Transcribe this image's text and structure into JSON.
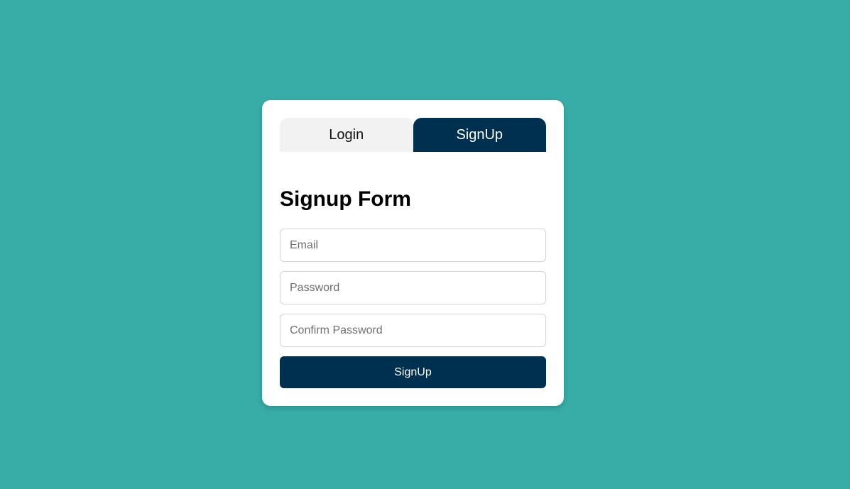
{
  "tabs": [
    {
      "label": "Login",
      "active": false
    },
    {
      "label": "SignUp",
      "active": true
    }
  ],
  "form": {
    "title": "Signup Form",
    "email": {
      "placeholder": "Email",
      "value": ""
    },
    "password": {
      "placeholder": "Password",
      "value": ""
    },
    "confirm_password": {
      "placeholder": "Confirm Password",
      "value": ""
    },
    "submit_label": "SignUp"
  },
  "colors": {
    "background": "#38ada8",
    "primary": "#003050",
    "tab_inactive": "#f2f2f2",
    "card": "#ffffff"
  }
}
